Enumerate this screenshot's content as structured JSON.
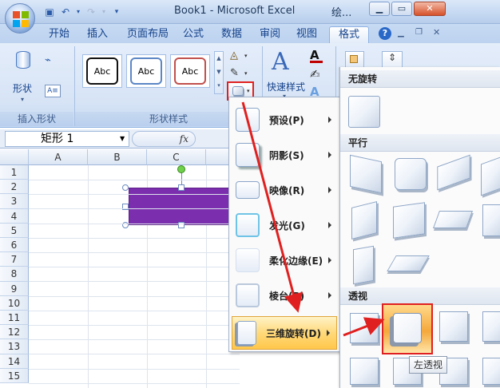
{
  "window": {
    "title": "Book1 - Microsoft Excel",
    "context_title": "绘..."
  },
  "quick_access": {
    "save": "save-icon",
    "undo": "undo-icon",
    "redo": "redo-icon",
    "customize": "chevron-down-icon"
  },
  "tabs": [
    "开始",
    "插入",
    "页面布局",
    "公式",
    "数据",
    "审阅",
    "视图",
    "格式"
  ],
  "ribbon": {
    "shapes_label": "形状",
    "insert_shapes_group": "插入形状",
    "shape_styles_group": "形状样式",
    "style_sample": "Abc",
    "quick_styles": "快速样式"
  },
  "namebox": {
    "value": "矩形 1"
  },
  "formula_fx": "fx",
  "columns": [
    "A",
    "B",
    "C"
  ],
  "rows": [
    "1",
    "2",
    "3",
    "4",
    "5",
    "6",
    "7",
    "8",
    "9",
    "10",
    "11",
    "12",
    "13",
    "14",
    "15"
  ],
  "effects_menu": [
    {
      "label": "预设(P)"
    },
    {
      "label": "阴影(S)"
    },
    {
      "label": "映像(R)"
    },
    {
      "label": "发光(G)"
    },
    {
      "label": "柔化边缘(E)"
    },
    {
      "label": "棱台(B)"
    },
    {
      "label": "三维旋转(D)"
    }
  ],
  "rotation_gallery": {
    "none": "无旋转",
    "parallel": "平行",
    "perspective": "透视"
  },
  "tooltip": "左透视",
  "colors": {
    "shape_fill": "#7b2ead",
    "highlight": "#e02020"
  }
}
